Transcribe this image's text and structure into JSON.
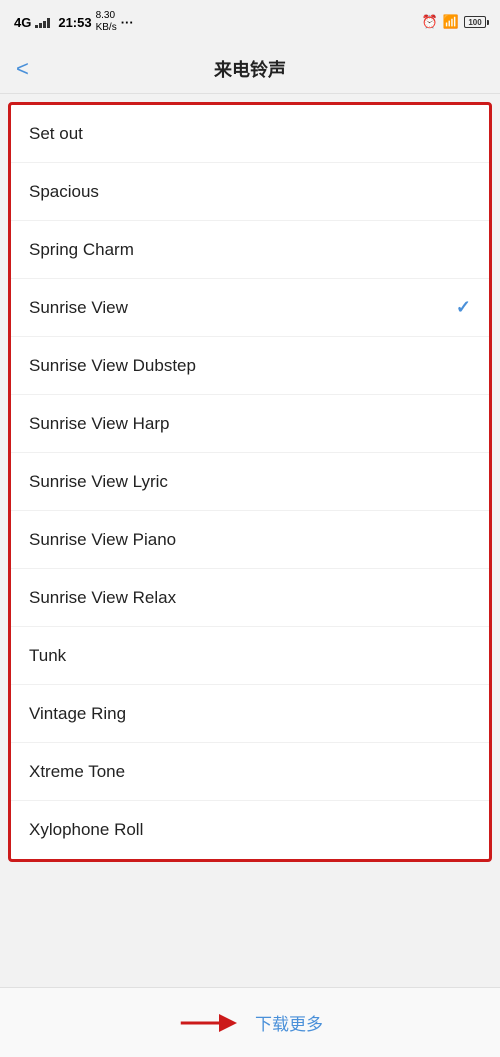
{
  "statusBar": {
    "carrier": "4G⁴⁶",
    "time": "21:53",
    "networkSpeed": "8.30\nKB/s",
    "dots": "···",
    "alarm": "⏰",
    "wifi": "WiFi",
    "battery": "100"
  },
  "navBar": {
    "backLabel": "<",
    "title": "来电铃声"
  },
  "listItems": [
    {
      "id": 1,
      "label": "Set out",
      "selected": false
    },
    {
      "id": 2,
      "label": "Spacious",
      "selected": false
    },
    {
      "id": 3,
      "label": "Spring Charm",
      "selected": false
    },
    {
      "id": 4,
      "label": "Sunrise View",
      "selected": true
    },
    {
      "id": 5,
      "label": "Sunrise View Dubstep",
      "selected": false
    },
    {
      "id": 6,
      "label": "Sunrise View Harp",
      "selected": false
    },
    {
      "id": 7,
      "label": "Sunrise View Lyric",
      "selected": false
    },
    {
      "id": 8,
      "label": "Sunrise View Piano",
      "selected": false
    },
    {
      "id": 9,
      "label": "Sunrise View Relax",
      "selected": false
    },
    {
      "id": 10,
      "label": "Tunk",
      "selected": false
    },
    {
      "id": 11,
      "label": "Vintage Ring",
      "selected": false
    },
    {
      "id": 12,
      "label": "Xtreme Tone",
      "selected": false
    },
    {
      "id": 13,
      "label": "Xylophone Roll",
      "selected": false
    }
  ],
  "bottomBar": {
    "downloadLabel": "下载更多"
  }
}
